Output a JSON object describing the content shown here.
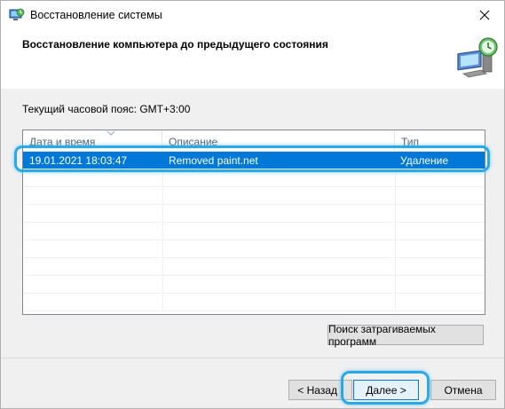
{
  "window": {
    "title": "Восстановление системы",
    "icon": "system-restore-icon"
  },
  "header": {
    "title": "Восстановление компьютера до предыдущего состояния",
    "icon": "restore-computer-icon"
  },
  "timezone_label": "Текущий часовой пояс: GMT+3:00",
  "table": {
    "columns": [
      "Дата и время",
      "Описание",
      "Тип"
    ],
    "sorted_column": "Дата и время",
    "rows": [
      {
        "date": "19.01.2021 18:03:47",
        "description": "Removed paint.net",
        "type": "Удаление",
        "selected": true
      }
    ]
  },
  "buttons": {
    "affected": "Поиск затрагиваемых программ",
    "back": "< Назад",
    "next": "Далее >",
    "cancel": "Отмена"
  },
  "colors": {
    "selection": "#0078d7",
    "highlight": "#29a9e5"
  }
}
